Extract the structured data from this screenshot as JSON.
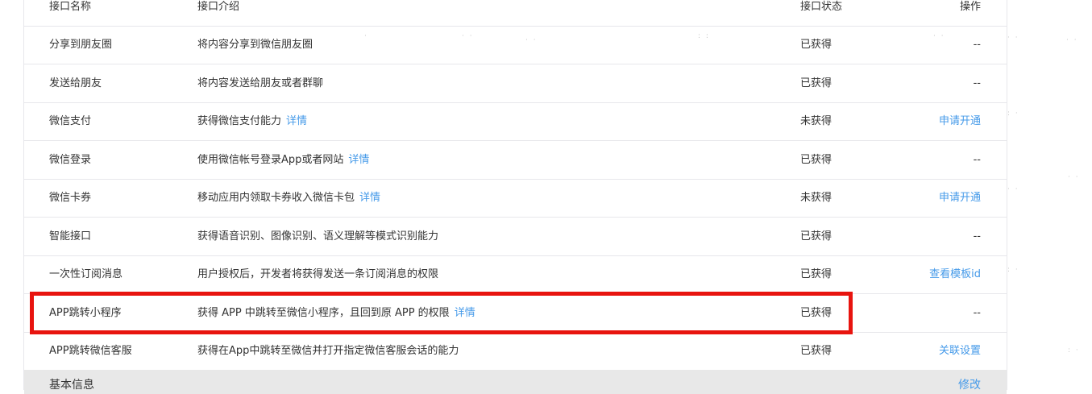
{
  "header": {
    "col_name": "接口名称",
    "col_desc": "接口介绍",
    "col_status": "接口状态",
    "col_op": "操作"
  },
  "rows": [
    {
      "name": "分享到朋友圈",
      "desc": "将内容分享到微信朋友圈",
      "detail": "",
      "status": "已获得",
      "op": "--",
      "op_link": false
    },
    {
      "name": "发送给朋友",
      "desc": "将内容发送给朋友或者群聊",
      "detail": "",
      "status": "已获得",
      "op": "--",
      "op_link": false
    },
    {
      "name": "微信支付",
      "desc": "获得微信支付能力",
      "detail": "详情",
      "status": "未获得",
      "op": "申请开通",
      "op_link": true
    },
    {
      "name": "微信登录",
      "desc": "使用微信帐号登录App或者网站",
      "detail": "详情",
      "status": "已获得",
      "op": "--",
      "op_link": false
    },
    {
      "name": "微信卡券",
      "desc": "移动应用内领取卡券收入微信卡包",
      "detail": "详情",
      "status": "未获得",
      "op": "申请开通",
      "op_link": true
    },
    {
      "name": "智能接口",
      "desc": "获得语音识别、图像识别、语义理解等模式识别能力",
      "detail": "",
      "status": "已获得",
      "op": "--",
      "op_link": false
    },
    {
      "name": "一次性订阅消息",
      "desc": "用户授权后，开发者将获得发送一条订阅消息的权限",
      "detail": "",
      "status": "已获得",
      "op": "查看模板id",
      "op_link": true
    },
    {
      "name": "APP跳转小程序",
      "desc": "获得 APP 中跳转至微信小程序，且回到原 APP 的权限",
      "detail": "详情",
      "status": "已获得",
      "op": "--",
      "op_link": false
    },
    {
      "name": "APP跳转微信客服",
      "desc": "获得在App中跳转至微信并打开指定微信客服会话的能力",
      "detail": "",
      "status": "已获得",
      "op": "关联设置",
      "op_link": true
    }
  ],
  "footer": {
    "title": "基本信息",
    "edit_label": "修改"
  },
  "colors": {
    "link": "#459ae9",
    "highlight": "#e8140f",
    "footer_bg": "#e8e8e8"
  }
}
